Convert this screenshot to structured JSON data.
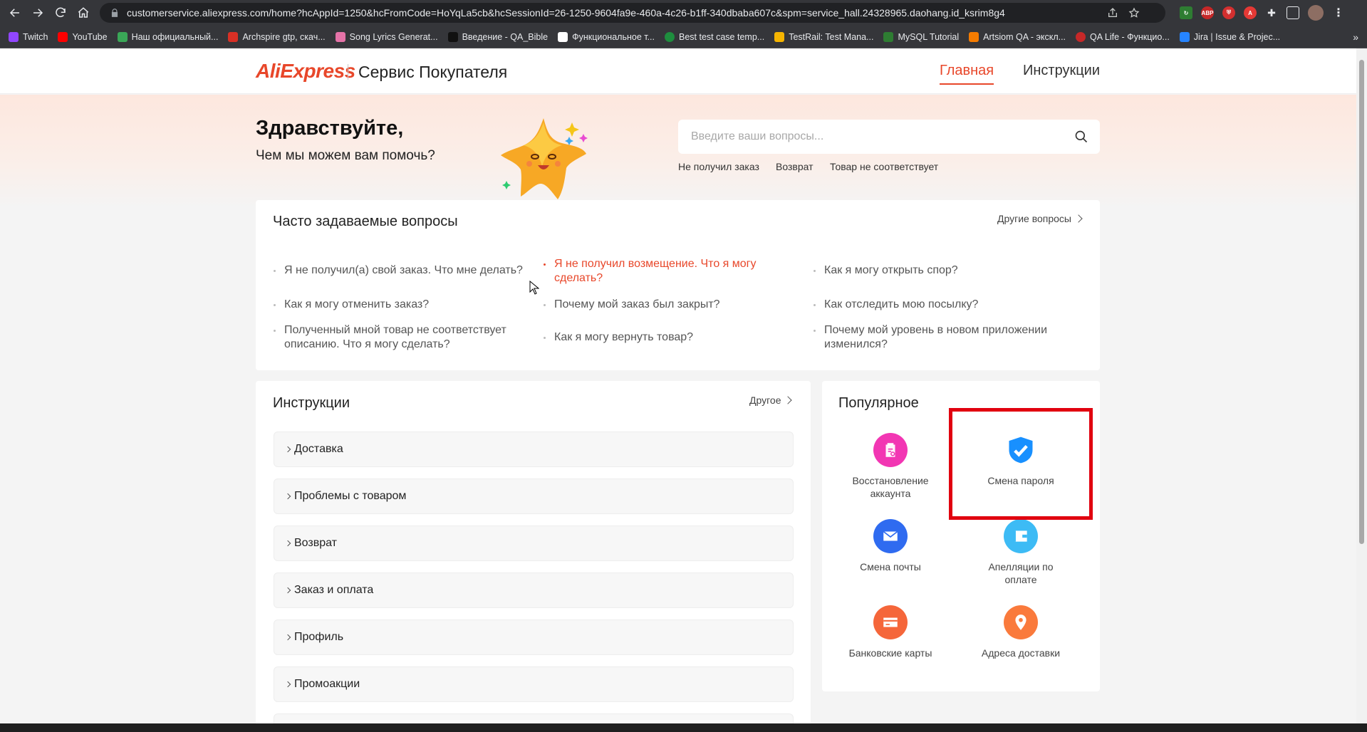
{
  "browser": {
    "url": "customerservice.aliexpress.com/home?hcAppId=1250&hcFromCode=HoYqLa5cb&hcSessionId=26-1250-9604fa9e-460a-4c26-b1ff-340dbaba607c&spm=service_hall.24328965.daohang.id_ksrim8g4",
    "bookmarks": [
      {
        "label": "Twitch",
        "color": "#9146ff"
      },
      {
        "label": "YouTube",
        "color": "#ff0000"
      },
      {
        "label": "Наш официальный...",
        "color": "#3aa757"
      },
      {
        "label": "Archspire gtp, скач...",
        "color": "#d93025"
      },
      {
        "label": "Song Lyrics Generat...",
        "color": "#e573a8"
      },
      {
        "label": "Введение - QA_Bible",
        "color": "#111111"
      },
      {
        "label": "Функциональное т...",
        "color": "#ffffff"
      },
      {
        "label": "Best test case temp...",
        "color": "#1e8e3e"
      },
      {
        "label": "TestRail: Test Mana...",
        "color": "#f5b400"
      },
      {
        "label": "MySQL Tutorial",
        "color": "#2e7d32"
      },
      {
        "label": "Artsiom QA - экскл...",
        "color": "#f57c00"
      },
      {
        "label": "QA Life - Функцио...",
        "color": "#c62828"
      },
      {
        "label": "Jira | Issue & Projec...",
        "color": "#2684ff"
      }
    ]
  },
  "header": {
    "logo": "AliExpress",
    "title": "Сервис Покупателя",
    "nav": {
      "home": "Главная",
      "instructions": "Инструкции"
    }
  },
  "hero": {
    "greeting": "Здравствуйте,",
    "subtitle": "Чем мы можем вам помочь?",
    "search_placeholder": "Введите ваши вопросы...",
    "quick_links": [
      "Не получил заказ",
      "Возврат",
      "Товар не соответствует"
    ]
  },
  "faq": {
    "title": "Часто задаваемые вопросы",
    "more": "Другие вопросы",
    "items": [
      "Я не получил(а) свой заказ. Что мне делать?",
      "Я не получил возмещение. Что я могу сделать?",
      "Как я могу открыть спор?",
      "Как я могу отменить заказ?",
      "Почему мой заказ был закрыт?",
      "Как отследить мою посылку?",
      "Полученный мной товар не соответствует описанию. Что я могу сделать?",
      "Как я могу вернуть товар?",
      "Почему мой уровень в новом приложении изменился?"
    ]
  },
  "instructions": {
    "title": "Инструкции",
    "more": "Другое",
    "items": [
      "Доставка",
      "Проблемы с товаром",
      "Возврат",
      "Заказ и оплата",
      "Профиль",
      "Промоакции"
    ]
  },
  "popular": {
    "title": "Популярное",
    "items": [
      {
        "label": "Восстановление аккаунта",
        "icon": "clipboard-search-icon",
        "color": "#f236b3"
      },
      {
        "label": "Смена пароля",
        "icon": "shield-check-icon",
        "color": "#1890ff"
      },
      {
        "label": "Смена почты",
        "icon": "envelope-icon",
        "color": "#2f6bf0"
      },
      {
        "label": "Апелляции по оплате",
        "icon": "wallet-icon",
        "color": "#3dbbf5"
      },
      {
        "label": "Банковские карты",
        "icon": "card-icon",
        "color": "#f5663a"
      },
      {
        "label": "Адреса доставки",
        "icon": "location-pin-icon",
        "color": "#fa7a3c"
      }
    ]
  }
}
